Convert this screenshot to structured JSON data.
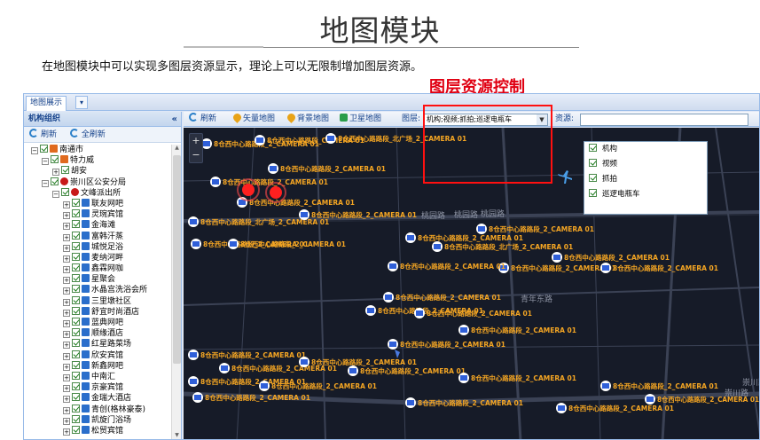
{
  "slide": {
    "title": "地图模块",
    "description": "在地图模块中可以实现多图层资源显示，理论上可以无限制增加图层资源。",
    "callout": "图层资源控制"
  },
  "tabs": [
    {
      "label": "地图展示"
    }
  ],
  "tab_menu_glyph": "▾",
  "left_panel": {
    "title": "机构组织",
    "collapse_glyph": "«",
    "toolbar": {
      "refresh": "刷新",
      "refresh_all": "全刷新"
    },
    "tree": [
      {
        "label": "南通市",
        "depth": 0,
        "icon": "org-icon"
      },
      {
        "label": "特力威",
        "depth": 1,
        "icon": "org-icon"
      },
      {
        "label": "胡安",
        "depth": 2,
        "icon": "none"
      },
      {
        "label": "崇川区公安分局",
        "depth": 1,
        "icon": "police-icon"
      },
      {
        "label": "文峰派出所",
        "depth": 2,
        "icon": "police-icon"
      },
      {
        "label": "联友网吧",
        "depth": 3,
        "icon": "camera-icon"
      },
      {
        "label": "灵琬宾馆",
        "depth": 3,
        "icon": "camera-icon"
      },
      {
        "label": "金海滩",
        "depth": 3,
        "icon": "camera-icon"
      },
      {
        "label": "富韩汗蒸",
        "depth": 3,
        "icon": "camera-icon"
      },
      {
        "label": "城悦足浴",
        "depth": 3,
        "icon": "camera-icon"
      },
      {
        "label": "麦纳河畔",
        "depth": 3,
        "icon": "camera-icon"
      },
      {
        "label": "鑫霖网咖",
        "depth": 3,
        "icon": "camera-icon"
      },
      {
        "label": "星聚会",
        "depth": 3,
        "icon": "camera-icon"
      },
      {
        "label": "水晶宫洗浴会所",
        "depth": 3,
        "icon": "camera-icon"
      },
      {
        "label": "三里墩社区",
        "depth": 3,
        "icon": "camera-icon"
      },
      {
        "label": "舒宜时尚酒店",
        "depth": 3,
        "icon": "camera-icon"
      },
      {
        "label": "蓝典网吧",
        "depth": 3,
        "icon": "camera-icon"
      },
      {
        "label": "顺缘酒店",
        "depth": 3,
        "icon": "camera-icon"
      },
      {
        "label": "红星路菜场",
        "depth": 3,
        "icon": "camera-icon"
      },
      {
        "label": "欣安宾馆",
        "depth": 3,
        "icon": "camera-icon"
      },
      {
        "label": "新鑫网吧",
        "depth": 3,
        "icon": "camera-icon"
      },
      {
        "label": "中南汇",
        "depth": 3,
        "icon": "camera-icon"
      },
      {
        "label": "京豪宾馆",
        "depth": 3,
        "icon": "camera-icon"
      },
      {
        "label": "金瑞大酒店",
        "depth": 3,
        "icon": "camera-icon"
      },
      {
        "label": "青创(格林豪泰)",
        "depth": 3,
        "icon": "camera-icon"
      },
      {
        "label": "凯旋门浴场",
        "depth": 3,
        "icon": "camera-icon"
      },
      {
        "label": "松贸宾馆",
        "depth": 3,
        "icon": "camera-icon"
      }
    ]
  },
  "map_toolbar": {
    "refresh": "刷新",
    "vector_map": "矢量地图",
    "background_map": "背景地图",
    "satellite_map": "卫星地图",
    "layer_label": "图层:",
    "layer_value": "机构;视频;抓拍;巡逻电瓶车",
    "search_label": "资源:",
    "zoom_in": "+",
    "zoom_out": "−"
  },
  "layer_options": [
    {
      "label": "机构",
      "checked": true
    },
    {
      "label": "视频",
      "checked": true
    },
    {
      "label": "抓拍",
      "checked": true
    },
    {
      "label": "巡逻电瓶车",
      "checked": true
    }
  ],
  "map": {
    "roads": [
      "桃园路",
      "桃园路",
      "桃园路",
      "青年东路",
      "崇川路",
      "崇川路"
    ],
    "markers": [
      "8仓西中心路路段_2_CAMERA 01",
      "8仓西中心路路段_CAMERA 01",
      "8仓西中心路路段_北广场_2_CAMERA 01",
      "8仓西中心路路段_2_CAMERA 01",
      "8仓西中心路路段_2_CAMERA 01",
      "8仓西中心路路段_2_CAMERA 01",
      "8仓西中心路路段_北广场_2_CAMERA 01",
      "8仓西中心路路段_2_CAMERA 01",
      "8仓西中心路路段_2_CAMERA 01",
      "8仓西中心路路段_2_CAMERA 01",
      "8仓西中心路路段_2_CAMERA 01",
      "8仓西中心路路段_2_CAMERA 01",
      "8仓西中心路路段_2_CAMERA 01",
      "8仓西中心路路段_北广场_2_CAMERA 01",
      "8仓西中心路路段_2_CAMERA 01",
      "8仓西中心路路段_2_CAMERA 01",
      "8仓西中心路路段_2_CAMERA 01",
      "8仓西中心路路段_2_CAMERA 01",
      "8仓西中心路路段_2_CAMERA 01",
      "8仓西中心路路段_2_CAMERA 01",
      "8仓西中心路路段_2_CAMERA 01",
      "8仓西中心路路段_2_CAMERA 01",
      "8仓西中心路路段_2_CAMERA 01",
      "8仓西中心路路段_2_CAMERA 01",
      "8仓西中心路路段_2_CAMERA 01",
      "8仓西中心路路段_2_CAMERA 01",
      "8仓西中心路路段_2_CAMERA 01",
      "8仓西中心路路段_2_CAMERA 01",
      "8仓西中心路路段_2_CAMERA 01",
      "8仓西中心路路段_2_CAMERA 01",
      "8仓西中心路路段_2_CAMERA 01",
      "8仓西中心路路段_2_CAMERA 01",
      "8仓西中心路路段_2_CAMERA 01",
      "8仓西中心路路段_2_CAMERA 01"
    ]
  },
  "colors": {
    "accent_red": "#ff1010",
    "map_bg": "#161b28",
    "marker_label": "#f5a623",
    "camera_marker": "#2f5fd8"
  }
}
